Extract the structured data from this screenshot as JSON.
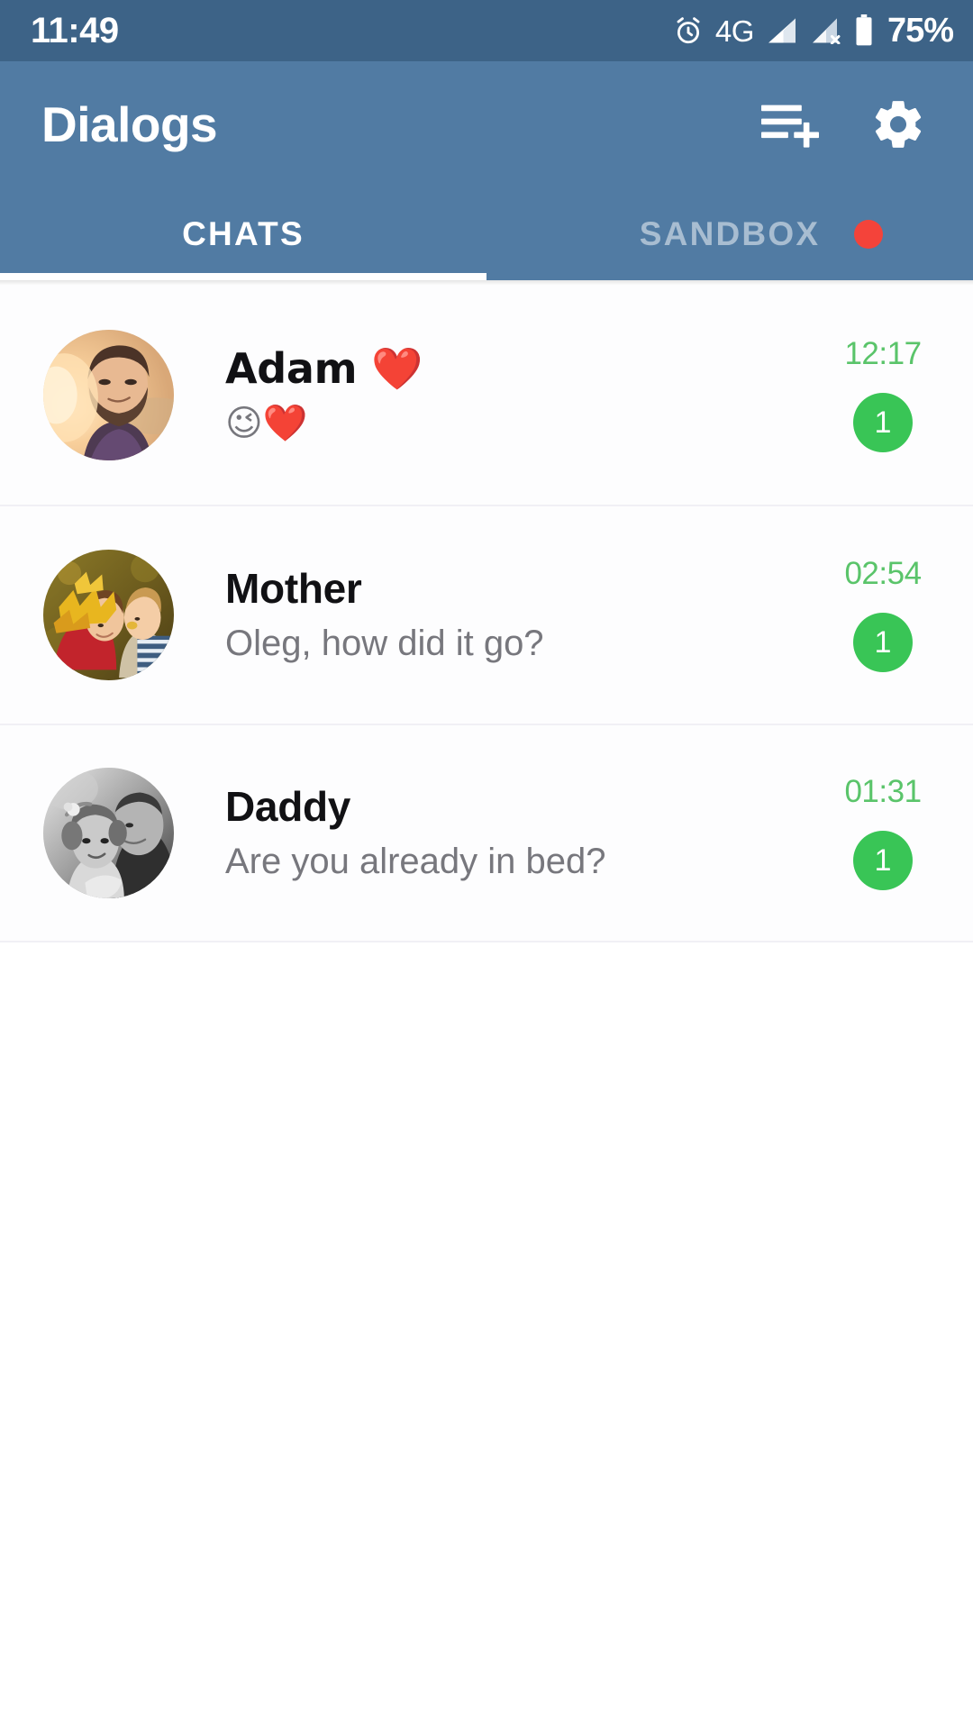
{
  "status_bar": {
    "clock": "11:49",
    "network_label": "4G",
    "battery_percent": "75%",
    "icons": [
      "alarm-icon",
      "signal-full-icon",
      "signal-no-sim-icon",
      "battery-icon"
    ],
    "background_color": "#3d6387"
  },
  "app_bar": {
    "title": "Dialogs",
    "background_color": "#517ba3",
    "actions": [
      {
        "name": "new-chat-button",
        "icon": "playlist-add-icon"
      },
      {
        "name": "settings-button",
        "icon": "gear-icon"
      }
    ]
  },
  "tabs": {
    "active_index": 0,
    "indicator_color": "#ffffff",
    "items": [
      {
        "label": "CHATS",
        "active": true,
        "badge": false
      },
      {
        "label": "SANDBOX",
        "active": false,
        "badge": true,
        "badge_color": "#f4433a"
      }
    ]
  },
  "chat_list": {
    "accent_time_color": "#5ac46a",
    "badge_color": "#39c556",
    "rows": [
      {
        "name": "Adam ❤️",
        "preview": "😉❤️",
        "time": "12:17",
        "unread": "1",
        "avatar_name": "avatar-adam",
        "avatar_alt": "bearded man in warm sunlight"
      },
      {
        "name": "Mother",
        "preview": "Oleg, how did it go?",
        "time": "02:54",
        "unread": "1",
        "avatar_name": "avatar-mother",
        "avatar_alt": "woman with autumn leaf crown and child"
      },
      {
        "name": "Daddy",
        "preview": "Are you already in bed?",
        "time": "01:31",
        "unread": "1",
        "avatar_name": "avatar-daddy",
        "avatar_alt": "black and white photo of father and daughter"
      }
    ]
  }
}
